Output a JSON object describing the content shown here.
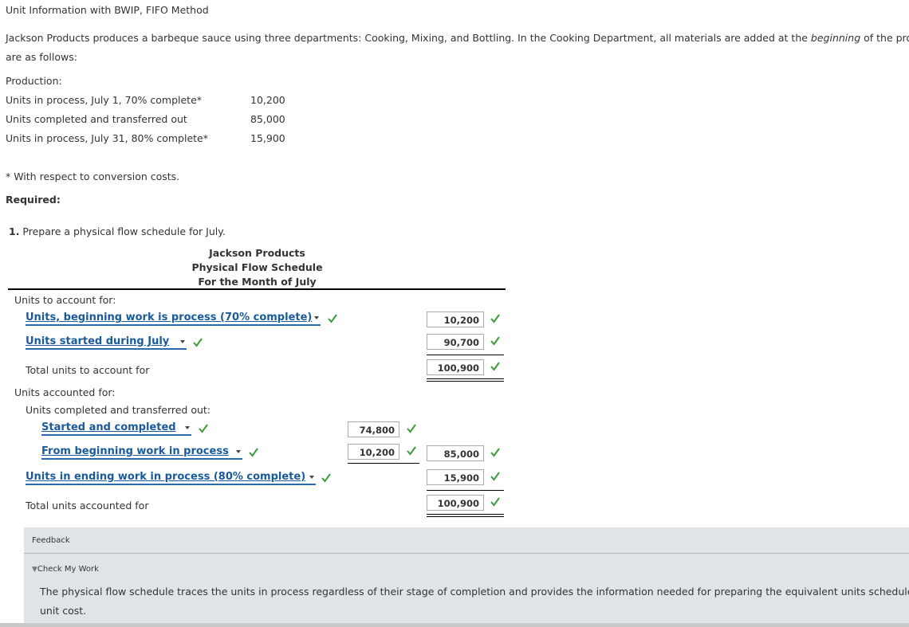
{
  "header": {
    "title": "Unit Information with BWIP, FIFO Method"
  },
  "intro": {
    "p1_start": "Jackson Products produces a barbeque sauce using three departments: Cooking, Mixing, and Bottling. In the Cooking Department, all materials are added at the ",
    "p1_em": "beginning",
    "p1_end": " of the process.",
    "p2": "are as follows:"
  },
  "production": {
    "heading": "Production:",
    "rows": [
      {
        "label": "Units in process, July 1, 70% complete*",
        "value": "10,200"
      },
      {
        "label": "Units completed and transferred out",
        "value": "85,000"
      },
      {
        "label": "Units in process, July 31, 80% complete*",
        "value": "15,900"
      }
    ],
    "footnote": "* With respect to conversion costs."
  },
  "required": "Required:",
  "question": {
    "number": "1.",
    "text": " Prepare a physical flow schedule for July."
  },
  "schedule": {
    "company": "Jackson Products",
    "title": "Physical Flow Schedule",
    "period": "For the Month of July",
    "to_account_heading": "Units to account for:",
    "sel_bwip": "Units, beginning work is process (70% complete)",
    "val_bwip": "10,200",
    "sel_started": "Units started during July",
    "val_started": "90,700",
    "total_to_account_label": "Total units to account for",
    "val_total_to_account": "100,900",
    "accounted_heading": "Units accounted for:",
    "completed_heading": "Units completed and transferred out:",
    "sel_started_completed": "Started and completed",
    "val_started_completed": "74,800",
    "sel_from_bwip": "From beginning work in process",
    "val_from_bwip": "10,200",
    "val_completed_total": "85,000",
    "sel_ewip": "Units in ending work in process (80% complete)",
    "val_ewip": "15,900",
    "total_accounted_label": "Total units accounted for",
    "val_total_accounted": "100,900"
  },
  "feedback": {
    "label": "Feedback",
    "toggle": "Check My Work",
    "text_line1": "The physical flow schedule traces the units in process regardless of their stage of completion and provides the information needed for preparing the equivalent units schedule. FIFO",
    "text_line2": "unit cost."
  },
  "colors": {
    "check": "#3c9a3c",
    "link": "#1a5a9a",
    "feedback_bg": "#dfe4e8"
  }
}
